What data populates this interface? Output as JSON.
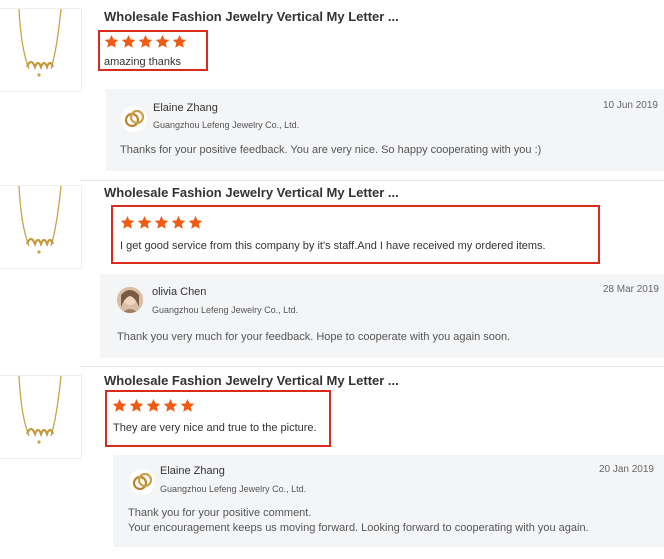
{
  "reviews": [
    {
      "product_title": "Wholesale Fashion Jewelry Vertical My Letter ...",
      "rating": 5,
      "review_text": "amazing thanks",
      "reply": {
        "name": "Elaine Zhang",
        "company": "Guangzhou Lefeng Jewelry Co., Ltd.",
        "date": "10 Jun 2019",
        "message_lines": [
          "Thanks for your positive feedback.  You are very nice.  So happy cooperating with you :)"
        ]
      }
    },
    {
      "product_title": "Wholesale Fashion Jewelry Vertical My Letter ...",
      "rating": 5,
      "review_text": "I get good service from this company by it's staff.And I have received my ordered items.",
      "reply": {
        "name": "olivia Chen",
        "company": "Guangzhou Lefeng Jewelry Co., Ltd.",
        "date": "28 Mar 2019",
        "message_lines": [
          "Thank you very much for your feedback. Hope to cooperate with you again soon."
        ]
      }
    },
    {
      "product_title": "Wholesale Fashion Jewelry Vertical My Letter ...",
      "rating": 5,
      "review_text": "They are very nice and true to the picture.",
      "reply": {
        "name": "Elaine Zhang",
        "company": "Guangzhou Lefeng Jewelry Co., Ltd.",
        "date": "20 Jan 2019",
        "message_lines": [
          "Thank you for your positive comment.",
          "Your encouragement keeps us moving forward. Looking forward to cooperating with you again."
        ]
      }
    }
  ],
  "colors": {
    "star": "#f05a12",
    "highlight_border": "#d92a1e",
    "reply_bg": "#f4f5f7"
  },
  "icons": {
    "star": "star-icon",
    "product": "necklace-thumbnail",
    "avatar_logo": "ring-logo-icon"
  }
}
